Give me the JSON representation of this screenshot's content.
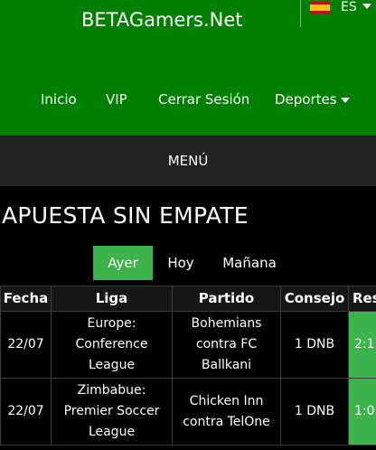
{
  "header": {
    "brand": "BETAGamers.Net",
    "lang": "ES",
    "nav": [
      "Inicio",
      "VIP",
      "Cerrar Sesión",
      "Deportes"
    ]
  },
  "menu": {
    "label": "MENÚ"
  },
  "page": {
    "title": "APUESTA SIN EMPATE"
  },
  "tabs": [
    "Ayer",
    "Hoy",
    "Mañana"
  ],
  "table": {
    "headers": [
      "Fecha",
      "Liga",
      "Partido",
      "Consejo",
      "Res"
    ],
    "rows": [
      {
        "fecha": "22/07",
        "liga": "Europe: Conference League",
        "partido": "Bohemians contra FC Ballkani",
        "consejo": "1 DNB",
        "res": "2:1"
      },
      {
        "fecha": "22/07",
        "liga": "Zimbabue: Premier Soccer League",
        "partido": "Chicken Inn contra TelOne",
        "consejo": "1 DNB",
        "res": "1:0"
      }
    ]
  },
  "colors": {
    "header_green": "#008000",
    "accent_green": "#3cb44b",
    "menu_bg": "#222222"
  }
}
